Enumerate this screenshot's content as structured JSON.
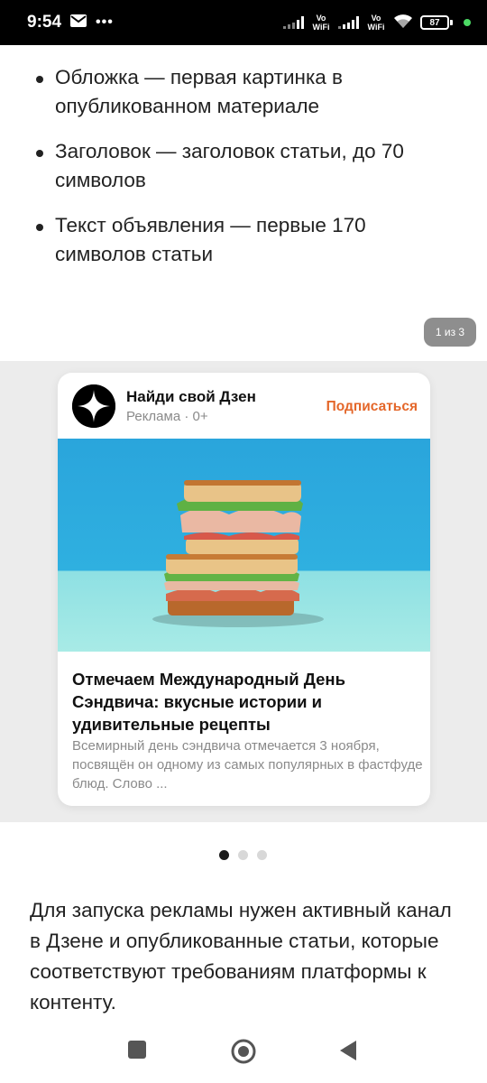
{
  "status_bar": {
    "time": "9:54",
    "network_label_1": "Vo WiFi",
    "network_label_2": "Vo WiFi",
    "battery": "87",
    "icons": [
      "mail-icon",
      "more-icon",
      "signal-icon",
      "wifi-icon",
      "battery-icon"
    ]
  },
  "bullets": [
    "Обложка — первая картинка в опубликованном материале",
    "Заголовок — заголовок статьи, до 70 символов",
    "Текст объявления — первые 170 символов статьи"
  ],
  "carousel": {
    "counter": "1 из 3",
    "active_index": 0,
    "total": 3
  },
  "ad_card": {
    "channel_name": "Найди свой Дзен",
    "meta": "Реклама · 0+",
    "subscribe_label": "Подписаться",
    "title": "Отмечаем Международный День Сэндвича: вкусные истории и удивительные рецепты",
    "description": "Всемирный день сэндвича отмечается 3 ноября, посвящён он одному из самых популярных в фастфуде блюд. Слово ...",
    "image": "sandwich-photo",
    "accent_color": "#e4672a"
  },
  "bottom_text": "Для запуска рекламы нужен активный канал в Дзене и опубликованные статьи, которые соответствуют требованиям платформы к контенту.",
  "nav_bar": {
    "buttons": [
      "recents-button",
      "home-button",
      "back-button"
    ]
  }
}
